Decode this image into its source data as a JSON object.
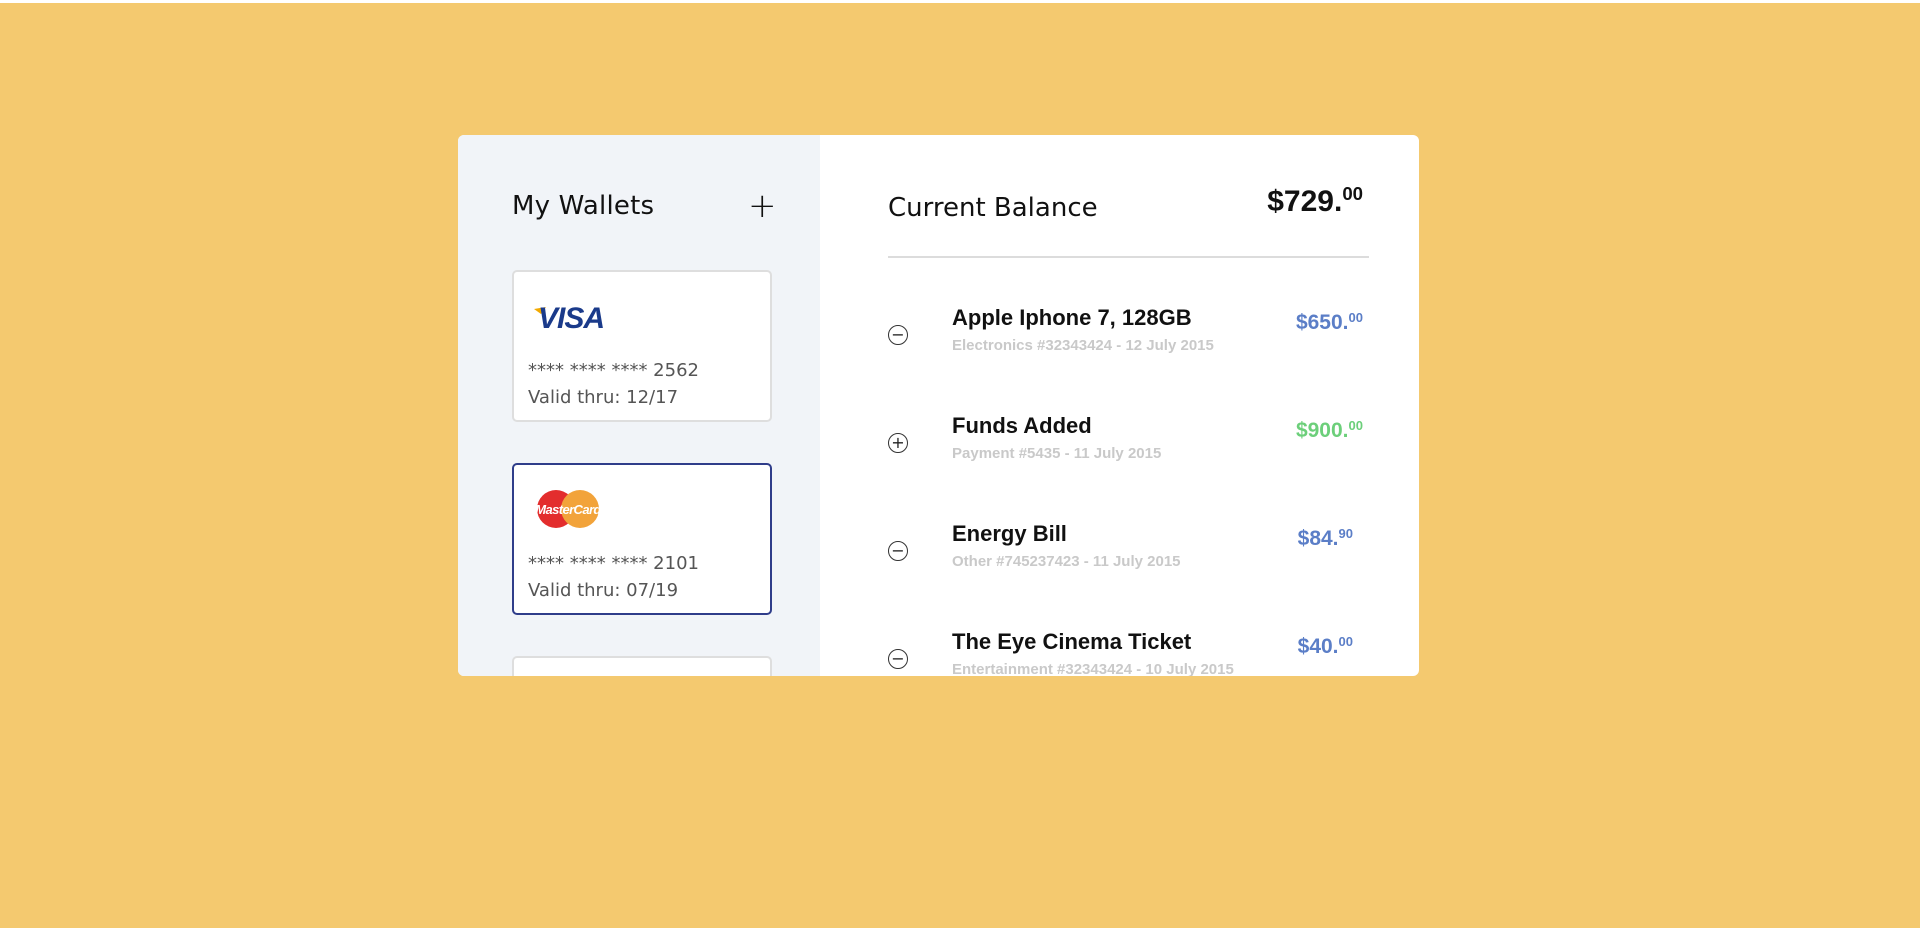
{
  "sidebar": {
    "title": "My Wallets",
    "add_icon": "plus-icon",
    "cards": [
      {
        "brand": "VISA",
        "logo_icon": "visa-logo",
        "number": "**** **** **** 2562",
        "valid": "Valid thru: 12/17",
        "selected": false
      },
      {
        "brand": "MasterCard",
        "logo_icon": "mastercard-logo",
        "number": "**** **** **** 2101",
        "valid": "Valid thru: 07/19",
        "selected": true
      }
    ]
  },
  "main": {
    "balance_label": "Current Balance",
    "balance_main": "$729.",
    "balance_cents": "00",
    "transactions": [
      {
        "icon": "minus-circle-icon",
        "title": "Apple Iphone 7, 128GB",
        "subtitle": "Electronics #32343424 - 12 July 2015",
        "amount_main": "$650.",
        "amount_cents": "00",
        "type": "debit"
      },
      {
        "icon": "plus-circle-icon",
        "title": "Funds Added",
        "subtitle": "Payment #5435 - 11 July 2015",
        "amount_main": "$900.",
        "amount_cents": "00",
        "type": "credit"
      },
      {
        "icon": "minus-circle-icon",
        "title": "Energy Bill",
        "subtitle": "Other #745237423 - 11 July 2015",
        "amount_main": "$84.",
        "amount_cents": "90",
        "type": "debit"
      },
      {
        "icon": "minus-circle-icon",
        "title": "The Eye Cinema Ticket",
        "subtitle": "Entertainment #32343424 - 10 July 2015",
        "amount_main": "$40.",
        "amount_cents": "00",
        "type": "debit"
      }
    ]
  },
  "colors": {
    "background": "#f4c96f",
    "sidebar": "#f1f4f8",
    "debit": "#5b7ec7",
    "credit": "#6ccf7a",
    "selected_border": "#2f3d8a"
  }
}
